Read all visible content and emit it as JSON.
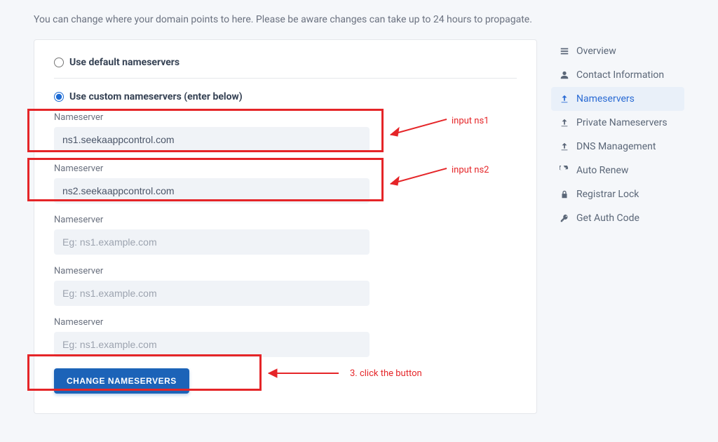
{
  "description": "You can change where your domain points to here. Please be aware changes can take up to 24 hours to propagate.",
  "option_default_label": "Use default nameservers",
  "option_custom_label": "Use custom nameservers (enter below)",
  "fields": [
    {
      "label": "Nameserver",
      "value": "ns1.seekaappcontrol.com",
      "placeholder": "Eg: ns1.example.com"
    },
    {
      "label": "Nameserver",
      "value": "ns2.seekaappcontrol.com",
      "placeholder": "Eg: ns1.example.com"
    },
    {
      "label": "Nameserver",
      "value": "",
      "placeholder": "Eg: ns1.example.com"
    },
    {
      "label": "Nameserver",
      "value": "",
      "placeholder": "Eg: ns1.example.com"
    },
    {
      "label": "Nameserver",
      "value": "",
      "placeholder": "Eg: ns1.example.com"
    }
  ],
  "submit_label": "CHANGE NAMESERVERS",
  "sidebar": {
    "items": [
      {
        "label": "Overview"
      },
      {
        "label": "Contact Information"
      },
      {
        "label": "Nameservers"
      },
      {
        "label": "Private Nameservers"
      },
      {
        "label": "DNS Management"
      },
      {
        "label": "Auto Renew"
      },
      {
        "label": "Registrar Lock"
      },
      {
        "label": "Get Auth Code"
      }
    ],
    "active_index": 2
  },
  "annotations": {
    "ns1": "input ns1",
    "ns2": "input ns2",
    "btn": "3. click the button"
  }
}
